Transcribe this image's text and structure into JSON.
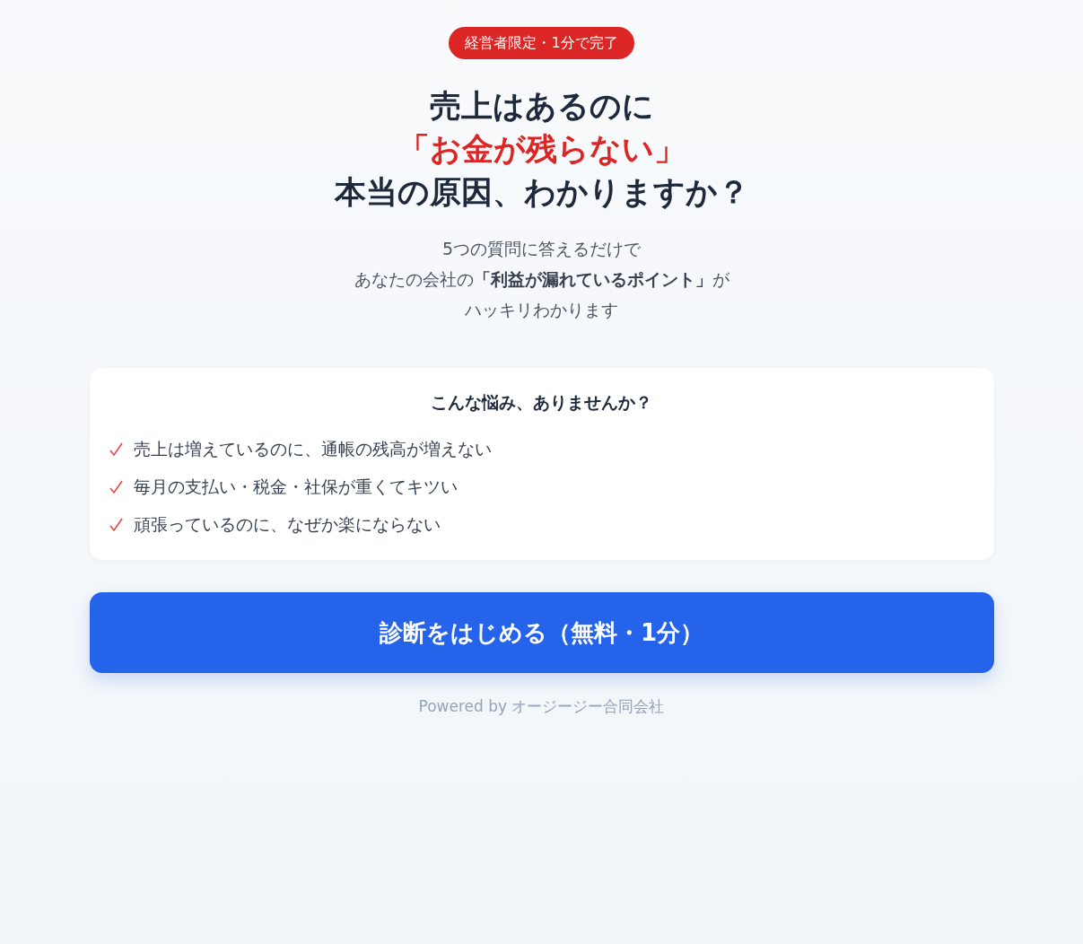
{
  "badge": "経営者限定・1分で完了",
  "headline": [
    {
      "text": "売上はあるのに",
      "kind": "plain"
    },
    {
      "text": "「お金が残らない」",
      "kind": "accent"
    },
    {
      "text": "本当の原因、わかりますか？",
      "kind": "plain"
    }
  ],
  "intro": [
    "5つの質問に答えるだけで",
    "あなたの会社の**「利益が漏れているポイント」**が",
    "ハッキリわかります"
  ],
  "concerns": {
    "title": "こんな悩み、ありませんか？",
    "items": [
      "売上は増えているのに、通帳の残高が増えない",
      "毎月の支払い・税金・社保が重くてキツい",
      "頑張っているのに、なぜか楽にならない"
    ]
  },
  "start_button": "診断をはじめる（無料・1分）",
  "footer": "Powered by オージージー合同会社"
}
